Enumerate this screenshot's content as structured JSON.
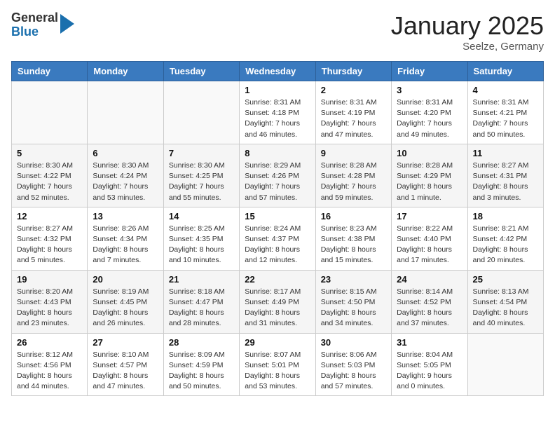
{
  "header": {
    "logo_general": "General",
    "logo_blue": "Blue",
    "month_title": "January 2025",
    "location": "Seelze, Germany"
  },
  "days_of_week": [
    "Sunday",
    "Monday",
    "Tuesday",
    "Wednesday",
    "Thursday",
    "Friday",
    "Saturday"
  ],
  "weeks": [
    [
      {
        "day": "",
        "info": ""
      },
      {
        "day": "",
        "info": ""
      },
      {
        "day": "",
        "info": ""
      },
      {
        "day": "1",
        "info": "Sunrise: 8:31 AM\nSunset: 4:18 PM\nDaylight: 7 hours and 46 minutes."
      },
      {
        "day": "2",
        "info": "Sunrise: 8:31 AM\nSunset: 4:19 PM\nDaylight: 7 hours and 47 minutes."
      },
      {
        "day": "3",
        "info": "Sunrise: 8:31 AM\nSunset: 4:20 PM\nDaylight: 7 hours and 49 minutes."
      },
      {
        "day": "4",
        "info": "Sunrise: 8:31 AM\nSunset: 4:21 PM\nDaylight: 7 hours and 50 minutes."
      }
    ],
    [
      {
        "day": "5",
        "info": "Sunrise: 8:30 AM\nSunset: 4:22 PM\nDaylight: 7 hours and 52 minutes."
      },
      {
        "day": "6",
        "info": "Sunrise: 8:30 AM\nSunset: 4:24 PM\nDaylight: 7 hours and 53 minutes."
      },
      {
        "day": "7",
        "info": "Sunrise: 8:30 AM\nSunset: 4:25 PM\nDaylight: 7 hours and 55 minutes."
      },
      {
        "day": "8",
        "info": "Sunrise: 8:29 AM\nSunset: 4:26 PM\nDaylight: 7 hours and 57 minutes."
      },
      {
        "day": "9",
        "info": "Sunrise: 8:28 AM\nSunset: 4:28 PM\nDaylight: 7 hours and 59 minutes."
      },
      {
        "day": "10",
        "info": "Sunrise: 8:28 AM\nSunset: 4:29 PM\nDaylight: 8 hours and 1 minute."
      },
      {
        "day": "11",
        "info": "Sunrise: 8:27 AM\nSunset: 4:31 PM\nDaylight: 8 hours and 3 minutes."
      }
    ],
    [
      {
        "day": "12",
        "info": "Sunrise: 8:27 AM\nSunset: 4:32 PM\nDaylight: 8 hours and 5 minutes."
      },
      {
        "day": "13",
        "info": "Sunrise: 8:26 AM\nSunset: 4:34 PM\nDaylight: 8 hours and 7 minutes."
      },
      {
        "day": "14",
        "info": "Sunrise: 8:25 AM\nSunset: 4:35 PM\nDaylight: 8 hours and 10 minutes."
      },
      {
        "day": "15",
        "info": "Sunrise: 8:24 AM\nSunset: 4:37 PM\nDaylight: 8 hours and 12 minutes."
      },
      {
        "day": "16",
        "info": "Sunrise: 8:23 AM\nSunset: 4:38 PM\nDaylight: 8 hours and 15 minutes."
      },
      {
        "day": "17",
        "info": "Sunrise: 8:22 AM\nSunset: 4:40 PM\nDaylight: 8 hours and 17 minutes."
      },
      {
        "day": "18",
        "info": "Sunrise: 8:21 AM\nSunset: 4:42 PM\nDaylight: 8 hours and 20 minutes."
      }
    ],
    [
      {
        "day": "19",
        "info": "Sunrise: 8:20 AM\nSunset: 4:43 PM\nDaylight: 8 hours and 23 minutes."
      },
      {
        "day": "20",
        "info": "Sunrise: 8:19 AM\nSunset: 4:45 PM\nDaylight: 8 hours and 26 minutes."
      },
      {
        "day": "21",
        "info": "Sunrise: 8:18 AM\nSunset: 4:47 PM\nDaylight: 8 hours and 28 minutes."
      },
      {
        "day": "22",
        "info": "Sunrise: 8:17 AM\nSunset: 4:49 PM\nDaylight: 8 hours and 31 minutes."
      },
      {
        "day": "23",
        "info": "Sunrise: 8:15 AM\nSunset: 4:50 PM\nDaylight: 8 hours and 34 minutes."
      },
      {
        "day": "24",
        "info": "Sunrise: 8:14 AM\nSunset: 4:52 PM\nDaylight: 8 hours and 37 minutes."
      },
      {
        "day": "25",
        "info": "Sunrise: 8:13 AM\nSunset: 4:54 PM\nDaylight: 8 hours and 40 minutes."
      }
    ],
    [
      {
        "day": "26",
        "info": "Sunrise: 8:12 AM\nSunset: 4:56 PM\nDaylight: 8 hours and 44 minutes."
      },
      {
        "day": "27",
        "info": "Sunrise: 8:10 AM\nSunset: 4:57 PM\nDaylight: 8 hours and 47 minutes."
      },
      {
        "day": "28",
        "info": "Sunrise: 8:09 AM\nSunset: 4:59 PM\nDaylight: 8 hours and 50 minutes."
      },
      {
        "day": "29",
        "info": "Sunrise: 8:07 AM\nSunset: 5:01 PM\nDaylight: 8 hours and 53 minutes."
      },
      {
        "day": "30",
        "info": "Sunrise: 8:06 AM\nSunset: 5:03 PM\nDaylight: 8 hours and 57 minutes."
      },
      {
        "day": "31",
        "info": "Sunrise: 8:04 AM\nSunset: 5:05 PM\nDaylight: 9 hours and 0 minutes."
      },
      {
        "day": "",
        "info": ""
      }
    ]
  ]
}
